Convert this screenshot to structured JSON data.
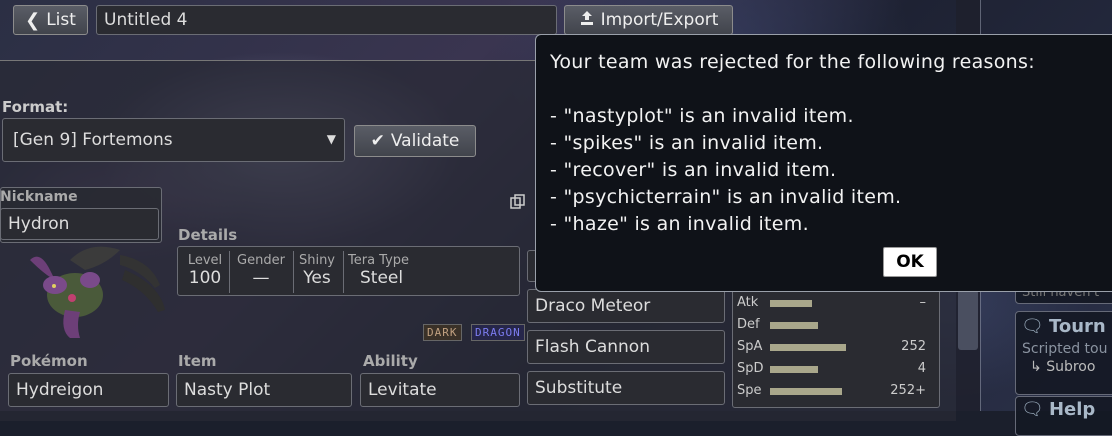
{
  "topbar": {
    "list_label": "List",
    "team_name": "Untitled 4",
    "import_export_label": "Import/Export"
  },
  "format": {
    "label": "Format:",
    "selected": "[Gen 9] Fortemons",
    "validate_label": "Validate"
  },
  "pokemon": {
    "nickname_label": "Nickname",
    "nickname": "Hydron",
    "details_label": "Details",
    "details": [
      {
        "label": "Level",
        "value": "100"
      },
      {
        "label": "Gender",
        "value": "—"
      },
      {
        "label": "Shiny",
        "value": "Yes"
      },
      {
        "label": "Tera Type",
        "value": "Steel"
      }
    ],
    "types": [
      "DARK",
      "DRAGON"
    ],
    "species_label": "Pokémon",
    "species": "Hydreigon",
    "item_label": "Item",
    "item": "Nasty Plot",
    "ability_label": "Ability",
    "ability": "Levitate",
    "moves": [
      "Draco Meteor",
      "Flash Cannon",
      "Substitute"
    ]
  },
  "stats": [
    {
      "label": "Atk",
      "value": "–",
      "bar": 0.42
    },
    {
      "label": "Def",
      "value": "",
      "bar": 0.48
    },
    {
      "label": "SpA",
      "value": "252",
      "bar": 0.76
    },
    {
      "label": "SpD",
      "value": "4",
      "bar": 0.48
    },
    {
      "label": "Spe",
      "value": "252+",
      "bar": 0.72
    }
  ],
  "dialog": {
    "heading": "Your team was rejected for the following reasons:",
    "reasons": [
      "- \"nastyplot\" is an invalid item.",
      "- \"spikes\" is an invalid item.",
      "- \"recover\" is an invalid item.",
      "- \"psychicterrain\" is an invalid item.",
      "- \"haze\" is an invalid item."
    ],
    "ok_label": "OK"
  },
  "sidebar": {
    "snippet_top": "Still haven't",
    "tournaments_title": "Tourn",
    "tournaments_sub": "Scripted tou",
    "subroom": "Subroo",
    "help_title": "Help"
  },
  "colors": {
    "dialog_bg": "#0f1218",
    "stat_bar": "#a9a78b",
    "dark_type": "#c0a080",
    "dragon_type": "#7c7cf0"
  }
}
